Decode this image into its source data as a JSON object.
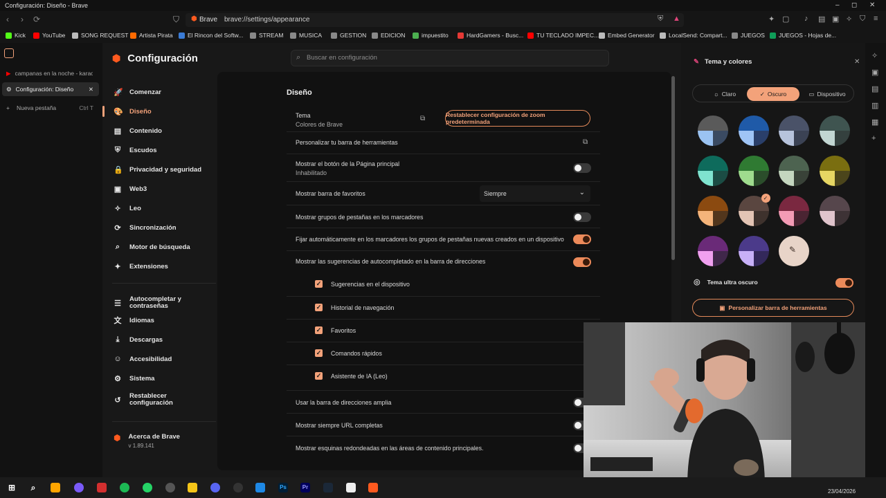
{
  "window": {
    "title": "Configuración: Diseño - Brave",
    "min": "–",
    "max": "◻",
    "close": "✕"
  },
  "toolbar": {
    "site_label": "Brave",
    "url": "brave://settings/appearance"
  },
  "bookmarks": [
    {
      "label": "Kick",
      "color": "#53fc18"
    },
    {
      "label": "YouTube",
      "color": "#ff0000"
    },
    {
      "label": "SONG REQUEST",
      "color": "#bbbbbb"
    },
    {
      "label": "Artista Pirata",
      "color": "#ff6a00"
    },
    {
      "label": "El Rincon del Softw...",
      "color": "#3a7bd5"
    },
    {
      "label": "STREAM",
      "color": "#888888"
    },
    {
      "label": "MUSICA",
      "color": "#888888"
    },
    {
      "label": "GESTION",
      "color": "#888888"
    },
    {
      "label": "EDICION",
      "color": "#888888"
    },
    {
      "label": "impuestito",
      "color": "#4caf50"
    },
    {
      "label": "HardGamers - Busc...",
      "color": "#e53935"
    },
    {
      "label": "TU TECLADO IMPEC...",
      "color": "#ff0000"
    },
    {
      "label": "Embed Generator",
      "color": "#bbbbbb"
    },
    {
      "label": "LocalSend: Compart...",
      "color": "#bbbbbb"
    },
    {
      "label": "JUEGOS",
      "color": "#888888"
    },
    {
      "label": "JUEGOS - Hojas de...",
      "color": "#0f9d58"
    }
  ],
  "tabs": [
    {
      "label": "campanas en la noche - karaok",
      "active": false
    },
    {
      "label": "Configuración: Diseño",
      "active": true
    }
  ],
  "new_tab": {
    "label": "Nueva pestaña",
    "shortcut": "Ctrl T"
  },
  "settings": {
    "title": "Configuración",
    "search_placeholder": "Buscar en configuración",
    "nav": [
      {
        "label": "Comenzar",
        "icon": "rocket-icon",
        "glyph": "🚀"
      },
      {
        "label": "Diseño",
        "icon": "palette-icon",
        "glyph": "🎨"
      },
      {
        "label": "Contenido",
        "icon": "content-icon",
        "glyph": "▤"
      },
      {
        "label": "Escudos",
        "icon": "shield-icon",
        "glyph": "⛨"
      },
      {
        "label": "Privacidad y seguridad",
        "icon": "lock-icon",
        "glyph": "🔒"
      },
      {
        "label": "Web3",
        "icon": "wallet-icon",
        "glyph": "▣"
      },
      {
        "label": "Leo",
        "icon": "leo-icon",
        "glyph": "✧"
      },
      {
        "label": "Sincronización",
        "icon": "sync-icon",
        "glyph": "⟳"
      },
      {
        "label": "Motor de búsqueda",
        "icon": "search-icon",
        "glyph": "⌕"
      },
      {
        "label": "Extensiones",
        "icon": "puzzle-icon",
        "glyph": "✦"
      }
    ],
    "nav2": [
      {
        "label": "Autocompletar y contraseñas",
        "icon": "list-icon",
        "glyph": "☰"
      },
      {
        "label": "Idiomas",
        "icon": "language-icon",
        "glyph": "文"
      },
      {
        "label": "Descargas",
        "icon": "download-icon",
        "glyph": "⤓"
      },
      {
        "label": "Accesibilidad",
        "icon": "accessibility-icon",
        "glyph": "☺"
      },
      {
        "label": "Sistema",
        "icon": "system-icon",
        "glyph": "⚙"
      },
      {
        "label": "Restablecer configuración",
        "icon": "reset-icon",
        "glyph": "↺"
      }
    ],
    "about": {
      "label": "Acerca de Brave",
      "version": "v 1.89.141"
    }
  },
  "main": {
    "section_title": "Diseño",
    "theme": {
      "label": "Tema",
      "value": "Colores de Brave",
      "reset_zoom": "Restablecer configuración de zoom predeterminada"
    },
    "customize_toolbar": "Personalizar tu barra de herramientas",
    "home_button": {
      "label": "Mostrar el botón de la Página principal",
      "sub": "Inhabilitado"
    },
    "bookmarks_bar": {
      "label": "Mostrar barra de favoritos",
      "value": "Siempre"
    },
    "tab_groups": "Mostrar grupos de pestañas en los marcadores",
    "pin_groups": "Fijar automáticamente en los marcadores los grupos de pestañas nuevas creados en un dispositivo",
    "autocomplete": "Mostrar las sugerencias de autocompletado en la barra de direcciones",
    "checks": [
      "Sugerencias en el dispositivo",
      "Historial de navegación",
      "Favoritos",
      "Comandos rápidos",
      "Asistente de IA (Leo)"
    ],
    "wide_bar": "Usar la barra de direcciones amplia",
    "full_urls": "Mostrar siempre URL completas",
    "rounded": "Mostrar esquinas redondeadas en las áreas de contenido principales."
  },
  "panel": {
    "title": "Tema y colores",
    "modes": [
      "Claro",
      "Oscuro",
      "Dispositivo"
    ],
    "ultra_dark": "Tema ultra oscuro",
    "customize_button": "Personalizar barra de herramientas",
    "swatches": [
      [
        "#5a5a5a",
        "#9bc3f2",
        "#3a4a62"
      ],
      [
        "#1f5aa8",
        "#9fc4f5",
        "#2a3f6a"
      ],
      [
        "#4a5268",
        "#b7c3dc",
        "#3b4254"
      ],
      [
        "#3f5450",
        "#c2d6d2",
        "#34403e"
      ],
      [
        "#0e6b5c",
        "#7fe3cf",
        "#1b4c44"
      ],
      [
        "#2f7a32",
        "#9fdc8e",
        "#2b4d2b"
      ],
      [
        "#4d6350",
        "#c4d6bf",
        "#394238"
      ],
      [
        "#7a6e10",
        "#e6d663",
        "#4b451b"
      ],
      [
        "#8b4a10",
        "#f5b47a",
        "#52361c"
      ],
      [
        "#5a4640",
        "#e3c4b4",
        "#3e322d"
      ],
      [
        "#7a2840",
        "#f39bb5",
        "#4a2432"
      ],
      [
        "#56464c",
        "#e0c4cc",
        "#3d3235"
      ],
      [
        "#6a2a78",
        "#f0a0ef",
        "#40274a"
      ],
      [
        "#4b3a8a",
        "#c7b0f7",
        "#33285a"
      ]
    ]
  },
  "taskbar": {
    "time": "23/04/2026"
  }
}
